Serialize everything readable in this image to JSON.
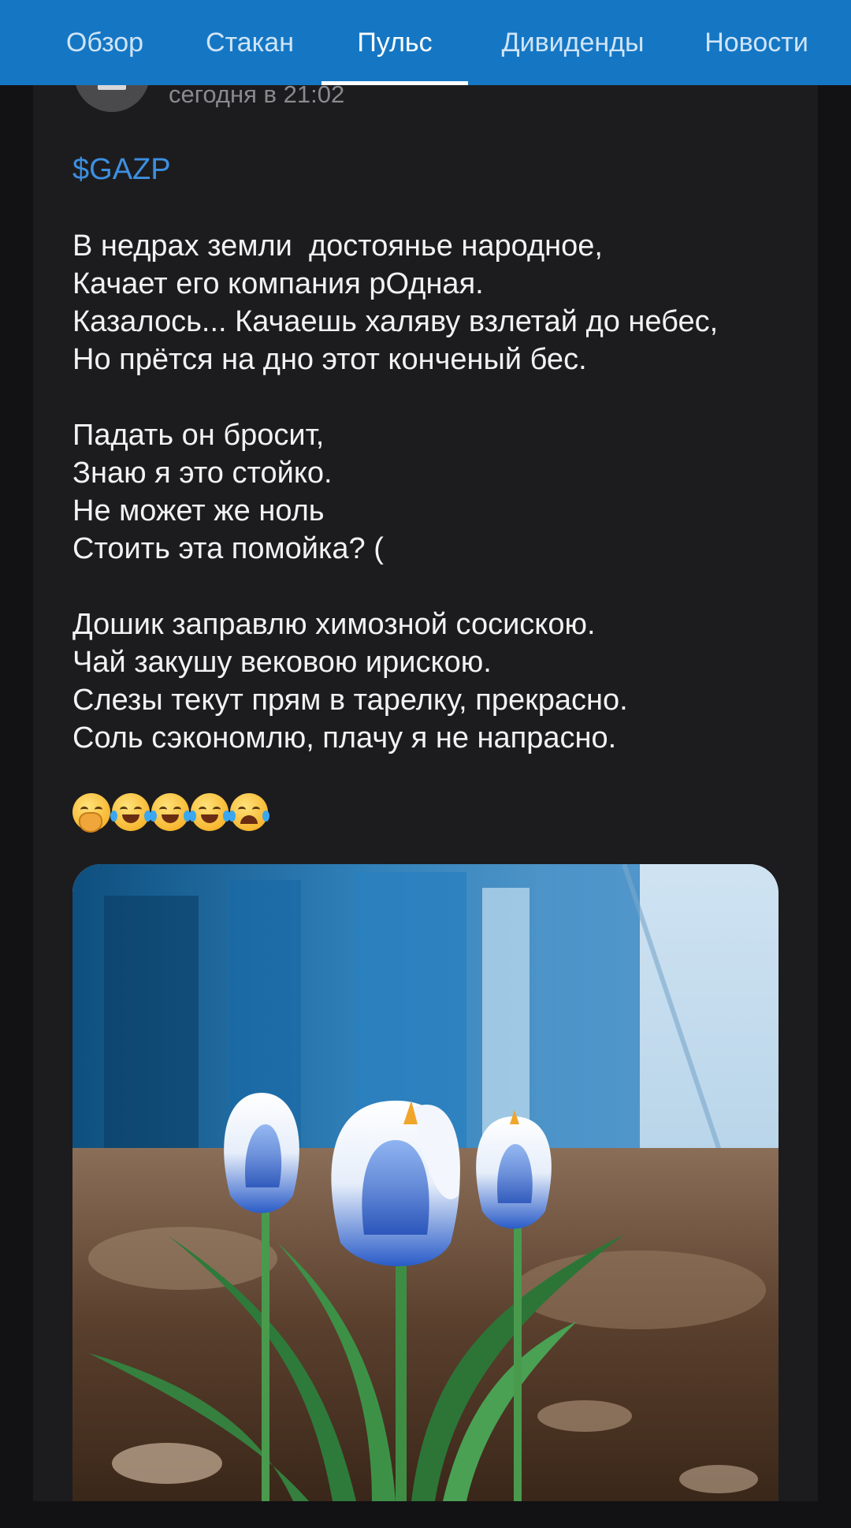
{
  "tabs": [
    {
      "label": "Обзор",
      "active": false
    },
    {
      "label": "Стакан",
      "active": false
    },
    {
      "label": "Пульс",
      "active": true
    },
    {
      "label": "Дивиденды",
      "active": false
    },
    {
      "label": "Новости",
      "active": false
    }
  ],
  "post": {
    "timestamp": "сегодня в 21:02",
    "ticker": "$GAZP",
    "stanzas": [
      [
        "В недрах земли  достоянье народное,",
        "Качает его компания рОдная.",
        "Казалось... Качаешь халяву взлетай до небес,",
        "Но прётся на дно этот конченый бес."
      ],
      [
        "Падать он бросит,",
        "Знаю я это стойко.",
        "Не может же ноль",
        "Стоить эта помойка? ("
      ],
      [
        "Дошик заправлю химозной сосискою.",
        "Чай закушу вековою ирискою.",
        "Слезы текут прям в тарелку, прекрасно.",
        "Соль сэкономлю, плачу я не напрасно."
      ]
    ],
    "emojis": [
      "hand-over-mouth-emoji",
      "tears-of-joy-emoji",
      "tears-of-joy-emoji",
      "tears-of-joy-emoji",
      "loudly-crying-emoji"
    ]
  },
  "colors": {
    "tabbar": "#1577c4",
    "ticker": "#3d8fe0",
    "card": "#1c1c1e"
  }
}
